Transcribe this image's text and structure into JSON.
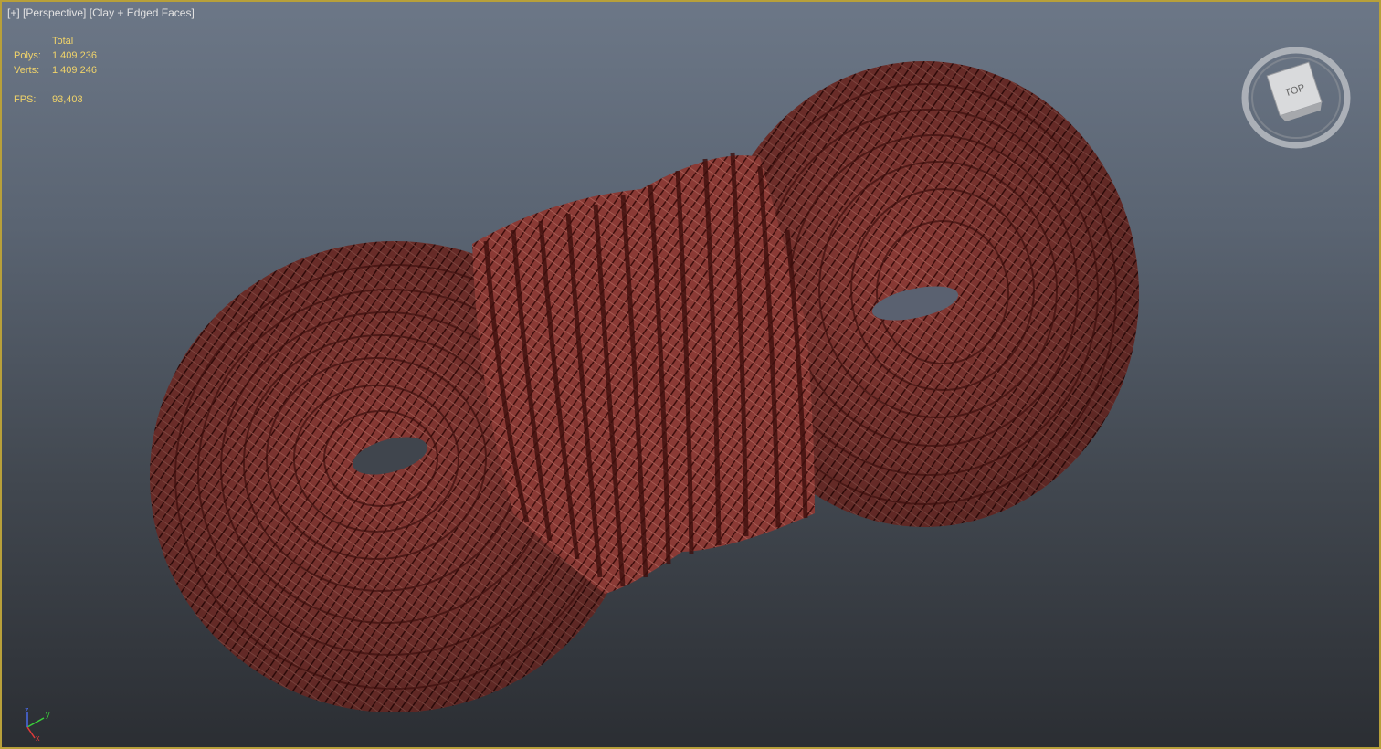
{
  "viewport": {
    "label_parts": [
      "[+]",
      "[Perspective]",
      "[Clay + Edged Faces]"
    ],
    "border_color": "#b8a03a"
  },
  "stats": {
    "header": "Total",
    "polys_label": "Polys:",
    "polys_value": "1 409 236",
    "verts_label": "Verts:",
    "verts_value": "1 409 246",
    "fps_label": "FPS:",
    "fps_value": "93,403",
    "text_color": "#f0d36a"
  },
  "viewcube": {
    "face_label": "TOP",
    "icon": "viewcube-icon"
  },
  "axis_gizmo": {
    "x_label": "x",
    "y_label": "y",
    "z_label": "z"
  },
  "model": {
    "name_icon": "rope-coil-model",
    "color": "#7a2a26"
  }
}
